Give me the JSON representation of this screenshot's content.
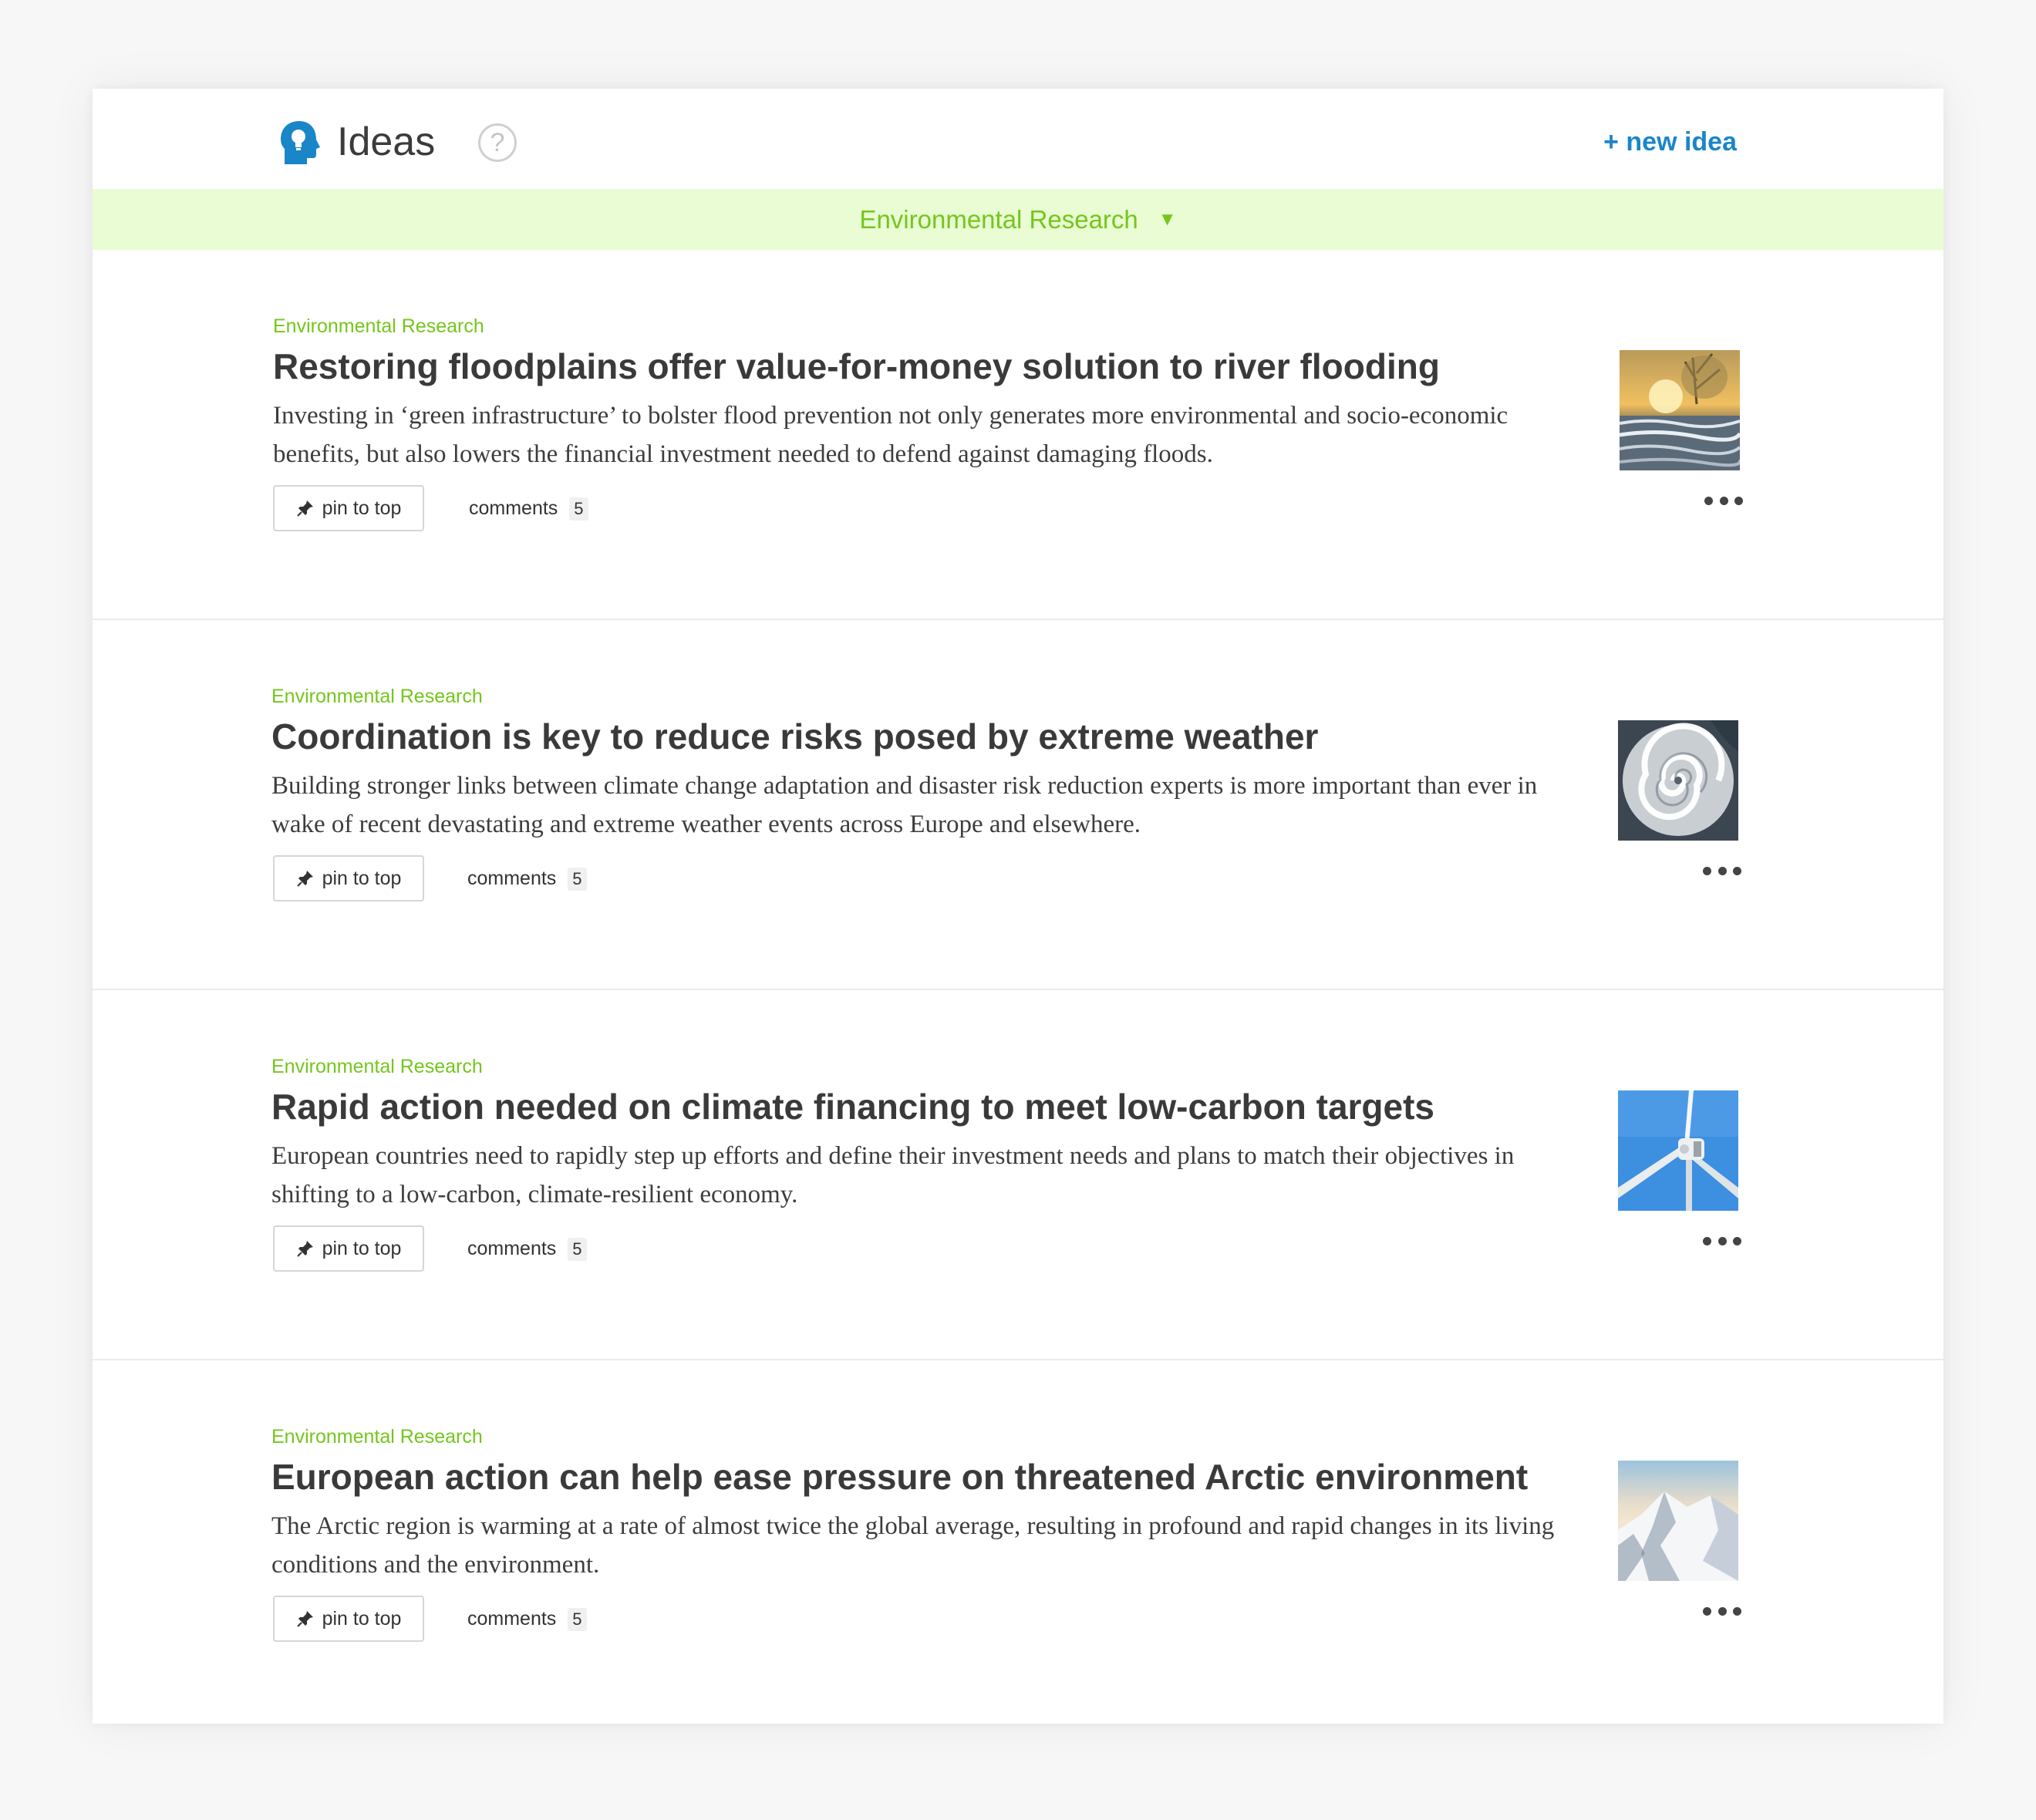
{
  "header": {
    "title": "Ideas",
    "help_label": "?",
    "new_idea_label": "+ new idea"
  },
  "filter": {
    "selected": "Environmental Research",
    "caret": "▼"
  },
  "ideas": [
    {
      "category": "Environmental Research",
      "title": "Restoring floodplains offer value-for-money solution to river flooding",
      "description": "Investing in ‘green infrastructure’ to bolster flood prevention not only generates more environmental and socio-economic benefits, but also lowers the financial investment needed to defend against damaging floods.",
      "thumbnail": "river-at-sunset",
      "pin_label": "pin to top",
      "comments_label": "comments",
      "comments_count": "5"
    },
    {
      "category": "Environmental Research",
      "title": "Coordination is key to reduce risks posed by extreme weather",
      "description": "Building stronger links between climate change adaptation and disaster risk reduction experts is more important than ever in wake of recent devastating and extreme weather events across Europe and elsewhere.",
      "thumbnail": "hurricane-satellite",
      "pin_label": "pin to top",
      "comments_label": "comments",
      "comments_count": "5"
    },
    {
      "category": "Environmental Research",
      "title": "Rapid action needed on climate financing to meet low-carbon targets",
      "description": "European countries need to rapidly step up efforts and define their investment needs and plans to match their objectives in shifting to a low-carbon, climate-resilient economy.",
      "thumbnail": "wind-turbine",
      "pin_label": "pin to top",
      "comments_label": "comments",
      "comments_count": "5"
    },
    {
      "category": "Environmental Research",
      "title": "European action can help ease pressure on threatened Arctic environment",
      "description": "The Arctic region is warming at a rate of almost twice the global average, resulting in profound and rapid changes in its living conditions and the environment.",
      "thumbnail": "snowy-mountain",
      "pin_label": "pin to top",
      "comments_label": "comments",
      "comments_count": "5"
    }
  ],
  "colors": {
    "accent_green": "#74c61c",
    "filter_bg": "#e9fcd3",
    "link_blue": "#1a86c8",
    "logo_blue": "#1a86c8"
  },
  "icons": {
    "logo": "head-lightbulb-icon",
    "help": "help-icon",
    "pin": "pin-icon",
    "more": "more-dots-icon"
  }
}
